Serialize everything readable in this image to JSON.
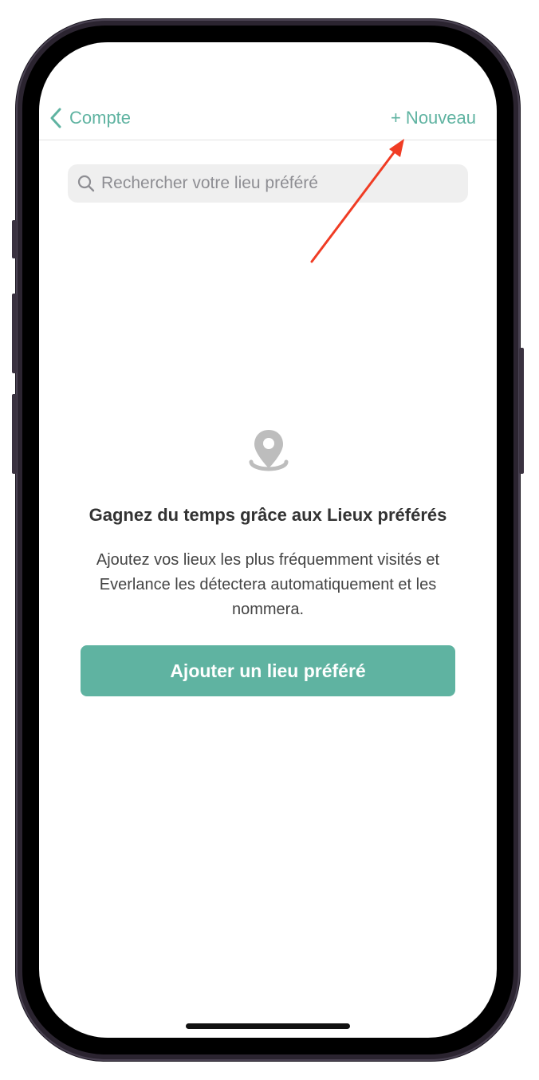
{
  "nav": {
    "back_label": "Compte",
    "new_label": "+ Nouveau"
  },
  "search": {
    "placeholder": "Rechercher votre lieu préféré"
  },
  "empty_state": {
    "icon": "location-pin-icon",
    "headline": "Gagnez du temps grâce aux Lieux préférés",
    "body": "Ajoutez vos lieux les plus fréquemment visités et Everlance les détectera automatiquement et les nommera.",
    "cta_label": "Ajouter un lieu préféré"
  },
  "colors": {
    "accent": "#5fb3a1",
    "annotation_arrow": "#f03c24",
    "search_bg": "#efefef"
  }
}
